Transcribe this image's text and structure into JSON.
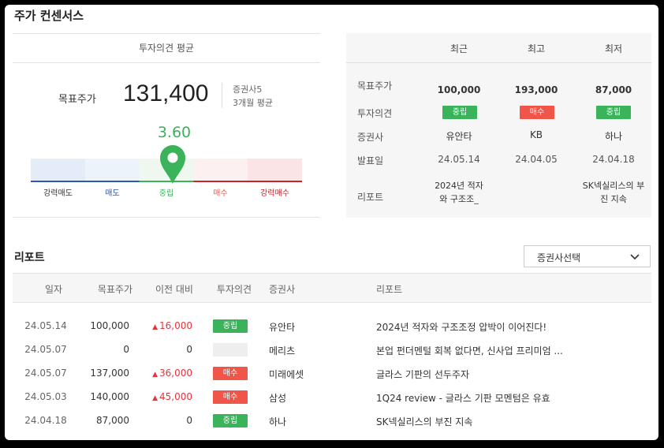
{
  "consensus": {
    "title": "주가 컨센서스",
    "avg_header": "투자의견 평균",
    "target_label": "목표주가",
    "target_value": "131,400",
    "brokers_count": "증권사5",
    "period": "3개월 평균",
    "score": "3.60",
    "scale_labels": [
      "강력매도",
      "매도",
      "중립",
      "매수",
      "강력매수"
    ]
  },
  "summary": {
    "columns": [
      "최근",
      "최고",
      "최저"
    ],
    "row_labels": [
      "목표주가",
      "투자의견",
      "증권사",
      "발표일",
      "리포트"
    ],
    "recent": {
      "target": "100,000",
      "opinion": "중립",
      "broker": "유안타",
      "date": "24.05.14",
      "report": "2024년 적자와 구조조_"
    },
    "high": {
      "target": "193,000",
      "opinion": "매수",
      "broker": "KB",
      "date": "24.04.05",
      "report": ""
    },
    "low": {
      "target": "87,000",
      "opinion": "중립",
      "broker": "하나",
      "date": "24.04.18",
      "report": "SK넥실리스의 부진 지속"
    }
  },
  "reports": {
    "title": "리포트",
    "select_label": "증권사선택",
    "headers": [
      "일자",
      "목표주가",
      "이전 대비",
      "투자의견",
      "증권사",
      "리포트"
    ],
    "rows": [
      {
        "date": "24.05.14",
        "target": "100,000",
        "change": "16,000",
        "opinion": "중립",
        "broker": "유안타",
        "report": "2024년 적자와 구조조정 압박이 이어진다!"
      },
      {
        "date": "24.05.07",
        "target": "0",
        "change": "0",
        "opinion": "",
        "broker": "메리츠",
        "report": "본업 펀더멘털 회복 없다면, 신사업 프리미엄 ..."
      },
      {
        "date": "24.05.07",
        "target": "137,000",
        "change": "36,000",
        "opinion": "매수",
        "broker": "미래에셋",
        "report": "글라스 기판의 선두주자"
      },
      {
        "date": "24.05.03",
        "target": "140,000",
        "change": "45,000",
        "opinion": "매수",
        "broker": "삼성",
        "report": "1Q24 review - 글라스 기판 모멘텀은 유효"
      },
      {
        "date": "24.04.18",
        "target": "87,000",
        "change": "0",
        "opinion": "중립",
        "broker": "하나",
        "report": "SK넥실리스의 부진 지속"
      }
    ]
  },
  "colors": {
    "green": "#3ab35a",
    "red": "#f0554a",
    "up": "#e8333a"
  }
}
